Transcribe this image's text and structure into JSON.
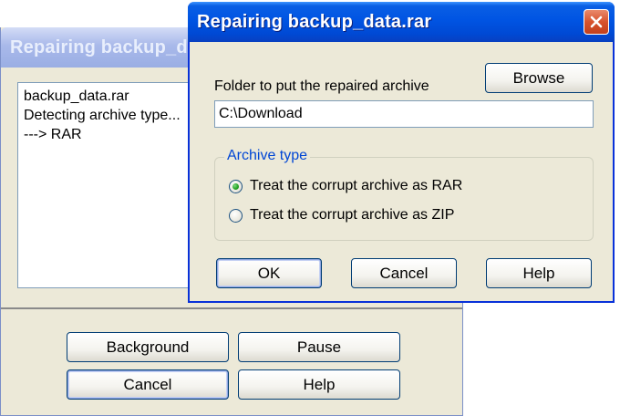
{
  "background_window": {
    "title": "Repairing backup_d",
    "log_lines": [
      "backup_data.rar",
      "Detecting archive type...",
      "---> RAR"
    ],
    "buttons": {
      "background": "Background",
      "pause": "Pause",
      "cancel": "Cancel",
      "help": "Help"
    }
  },
  "dialog": {
    "title": "Repairing backup_data.rar",
    "close_icon": "close-icon",
    "folder_label": "Folder to put the repaired archive",
    "browse_label": "Browse",
    "folder_value": "C:\\Download",
    "archive_type_label": "Archive type",
    "options": [
      {
        "label": "Treat the corrupt archive as RAR",
        "selected": true
      },
      {
        "label": "Treat the corrupt archive as ZIP",
        "selected": false
      }
    ],
    "buttons": {
      "ok": "OK",
      "cancel": "Cancel",
      "help": "Help"
    }
  },
  "colors": {
    "active_title": "#0054e3",
    "inactive_title": "#9aaee4",
    "dialog_face": "#ece9d8",
    "groupbox_label": "#0046d5",
    "close_button": "#d8532e"
  }
}
